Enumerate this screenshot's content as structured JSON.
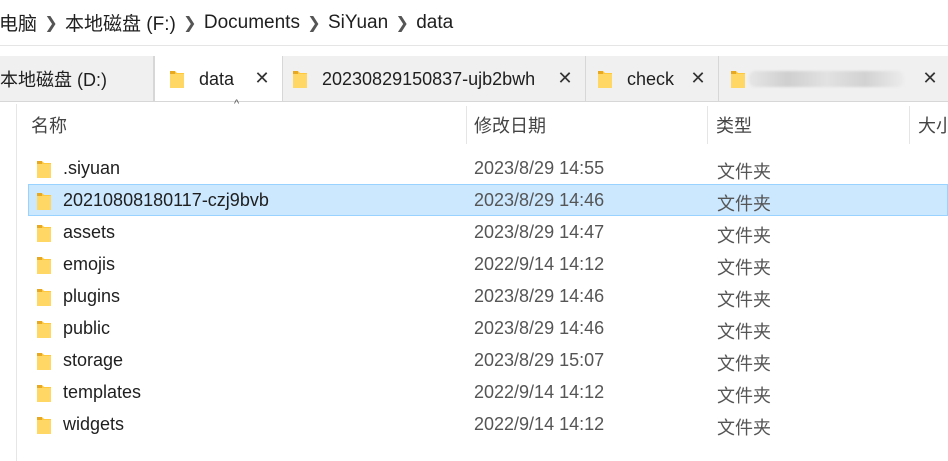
{
  "breadcrumb": [
    "电脑",
    "本地磁盘 (F:)",
    "Documents",
    "SiYuan",
    "data"
  ],
  "tabs": [
    {
      "label": "本地磁盘 (D:)",
      "has_icon": false,
      "close": "✕",
      "active": false
    },
    {
      "label": "data",
      "has_icon": true,
      "close": "✕",
      "active": true
    },
    {
      "label": "20230829150837-ujb2bwh",
      "has_icon": true,
      "close": "✕",
      "active": false
    },
    {
      "label": "check",
      "has_icon": true,
      "close": "✕",
      "active": false
    },
    {
      "label": "",
      "has_icon": true,
      "close": "✕",
      "active": false,
      "blurred": true
    }
  ],
  "columns": {
    "name": "名称",
    "date": "修改日期",
    "type": "类型",
    "size": "大小"
  },
  "sort_indicator": "^",
  "rows": [
    {
      "name": ".siyuan",
      "date": "2023/8/29 14:55",
      "type": "文件夹",
      "selected": false
    },
    {
      "name": "20210808180117-czj9bvb",
      "date": "2023/8/29 14:46",
      "type": "文件夹",
      "selected": true
    },
    {
      "name": "assets",
      "date": "2023/8/29 14:47",
      "type": "文件夹",
      "selected": false
    },
    {
      "name": "emojis",
      "date": "2022/9/14 14:12",
      "type": "文件夹",
      "selected": false
    },
    {
      "name": "plugins",
      "date": "2023/8/29 14:46",
      "type": "文件夹",
      "selected": false
    },
    {
      "name": "public",
      "date": "2023/8/29 14:46",
      "type": "文件夹",
      "selected": false
    },
    {
      "name": "storage",
      "date": "2023/8/29 15:07",
      "type": "文件夹",
      "selected": false
    },
    {
      "name": "templates",
      "date": "2022/9/14 14:12",
      "type": "文件夹",
      "selected": false
    },
    {
      "name": "widgets",
      "date": "2022/9/14 14:12",
      "type": "文件夹",
      "selected": false
    }
  ],
  "colors": {
    "selection_bg": "#cce8ff",
    "selection_border": "#99d1ff",
    "folder": "#ffc83d",
    "tabbar_bg": "#f0f0f0"
  }
}
